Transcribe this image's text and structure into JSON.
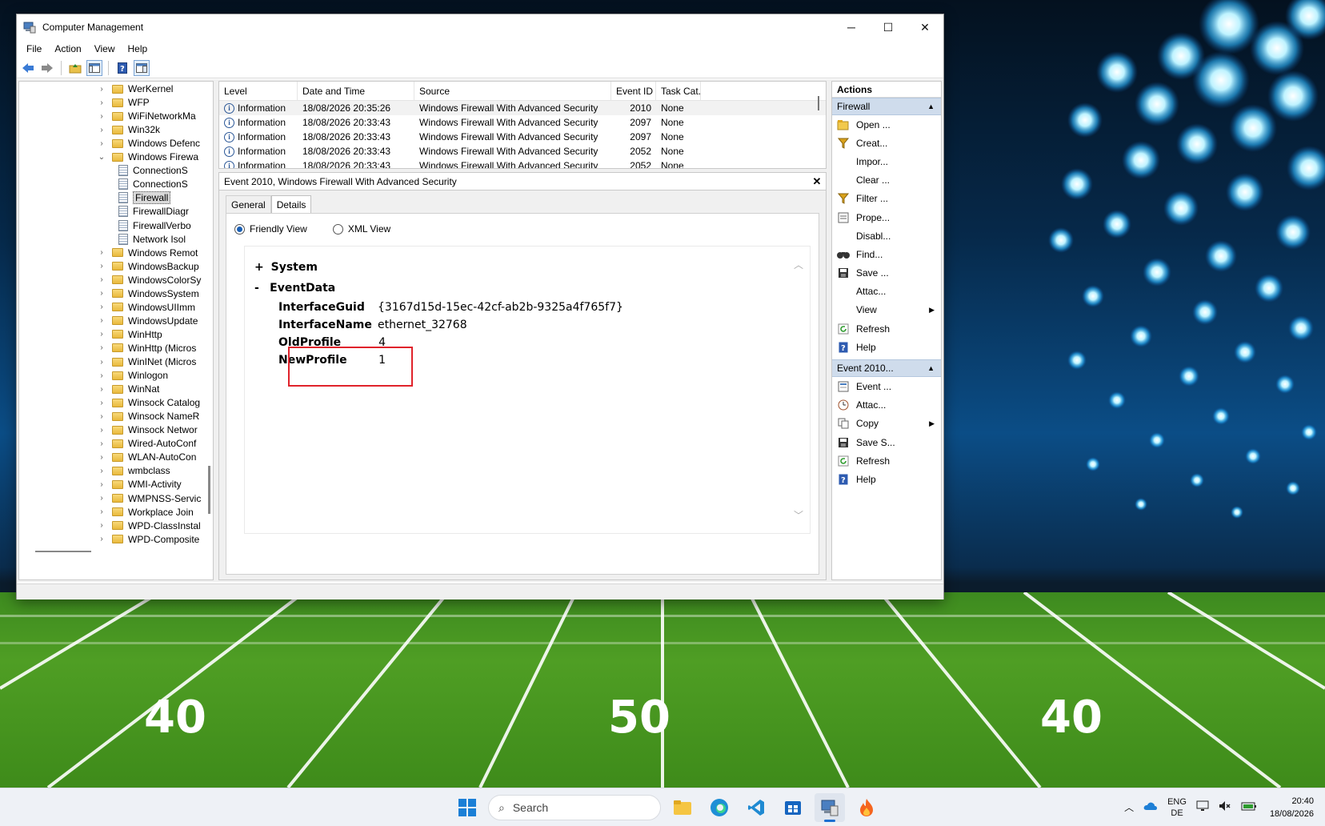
{
  "window": {
    "title": "Computer Management",
    "controls": {
      "minimize": "─",
      "maximize": "☐",
      "close": "✕"
    }
  },
  "menu": [
    "File",
    "Action",
    "View",
    "Help"
  ],
  "tree": {
    "items": [
      {
        "label": "WerKernel",
        "type": "folder",
        "expander": "›"
      },
      {
        "label": "WFP",
        "type": "folder",
        "expander": "›"
      },
      {
        "label": "WiFiNetworkMa",
        "type": "folder",
        "expander": "›"
      },
      {
        "label": "Win32k",
        "type": "folder",
        "expander": "›"
      },
      {
        "label": "Windows Defenc",
        "type": "folder",
        "expander": "›"
      },
      {
        "label": "Windows Firewa",
        "type": "folder",
        "expander": "⌄"
      },
      {
        "label": "ConnectionS",
        "type": "log",
        "expander": ""
      },
      {
        "label": "ConnectionS",
        "type": "log",
        "expander": ""
      },
      {
        "label": "Firewall",
        "type": "log",
        "expander": "",
        "selected": true
      },
      {
        "label": "FirewallDiagr",
        "type": "log",
        "expander": ""
      },
      {
        "label": "FirewallVerbo",
        "type": "log",
        "expander": ""
      },
      {
        "label": "Network Isol",
        "type": "log",
        "expander": ""
      },
      {
        "label": "Windows Remot",
        "type": "folder",
        "expander": "›"
      },
      {
        "label": "WindowsBackup",
        "type": "folder",
        "expander": "›"
      },
      {
        "label": "WindowsColorSy",
        "type": "folder",
        "expander": "›"
      },
      {
        "label": "WindowsSystem",
        "type": "folder",
        "expander": "›"
      },
      {
        "label": "WindowsUIImm",
        "type": "folder",
        "expander": "›"
      },
      {
        "label": "WindowsUpdate",
        "type": "folder",
        "expander": "›"
      },
      {
        "label": "WinHttp",
        "type": "folder",
        "expander": "›"
      },
      {
        "label": "WinHttp (Micros",
        "type": "folder",
        "expander": "›"
      },
      {
        "label": "WinINet (Micros",
        "type": "folder",
        "expander": "›"
      },
      {
        "label": "Winlogon",
        "type": "folder",
        "expander": "›"
      },
      {
        "label": "WinNat",
        "type": "folder",
        "expander": "›"
      },
      {
        "label": "Winsock Catalog",
        "type": "folder",
        "expander": "›"
      },
      {
        "label": "Winsock NameR",
        "type": "folder",
        "expander": "›"
      },
      {
        "label": "Winsock Networ",
        "type": "folder",
        "expander": "›"
      },
      {
        "label": "Wired-AutoConf",
        "type": "folder",
        "expander": "›"
      },
      {
        "label": "WLAN-AutoCon",
        "type": "folder",
        "expander": "›"
      },
      {
        "label": "wmbclass",
        "type": "folder",
        "expander": "›"
      },
      {
        "label": "WMI-Activity",
        "type": "folder",
        "expander": "›"
      },
      {
        "label": "WMPNSS-Servic",
        "type": "folder",
        "expander": "›"
      },
      {
        "label": "Workplace Join",
        "type": "folder",
        "expander": "›"
      },
      {
        "label": "WPD-ClassInstal",
        "type": "folder",
        "expander": "›"
      },
      {
        "label": "WPD-Composite",
        "type": "folder",
        "expander": "›"
      }
    ]
  },
  "events": {
    "columns": [
      "Level",
      "Date and Time",
      "Source",
      "Event ID",
      "Task Cat..."
    ],
    "rows": [
      {
        "level": "Information",
        "date": "18/08/2026 20:35:26",
        "source": "Windows Firewall With Advanced Security",
        "id": "2010",
        "task": "None",
        "selected": true
      },
      {
        "level": "Information",
        "date": "18/08/2026 20:33:43",
        "source": "Windows Firewall With Advanced Security",
        "id": "2097",
        "task": "None"
      },
      {
        "level": "Information",
        "date": "18/08/2026 20:33:43",
        "source": "Windows Firewall With Advanced Security",
        "id": "2097",
        "task": "None"
      },
      {
        "level": "Information",
        "date": "18/08/2026 20:33:43",
        "source": "Windows Firewall With Advanced Security",
        "id": "2052",
        "task": "None"
      },
      {
        "level": "Information",
        "date": "18/08/2026 20:33:43",
        "source": "Windows Firewall With Advanced Security",
        "id": "2052",
        "task": "None"
      }
    ]
  },
  "detail": {
    "title": "Event 2010, Windows Firewall With Advanced Security",
    "close": "✕",
    "tabs": [
      "General",
      "Details"
    ],
    "view_friendly": "Friendly View",
    "view_xml": "XML View",
    "system_toggle": "+",
    "system_label": "System",
    "eventdata_toggle": "-",
    "eventdata_label": "EventData",
    "fields": [
      {
        "name": "InterfaceGuid",
        "value": "{3167d15d-15ec-42cf-ab2b-9325a4f765f7}"
      },
      {
        "name": "InterfaceName",
        "value": "ethernet_32768"
      },
      {
        "name": "OldProfile",
        "value": "4"
      },
      {
        "name": "NewProfile",
        "value": "1"
      }
    ],
    "highlight_color": "#e0232b"
  },
  "actions": {
    "header": "Actions",
    "section1": {
      "title": "Firewall",
      "items": [
        {
          "label": "Open ...",
          "icon": "open-folder-icon"
        },
        {
          "label": "Creat...",
          "icon": "filter-icon"
        },
        {
          "label": "Impor...",
          "icon": ""
        },
        {
          "label": "Clear ...",
          "icon": ""
        },
        {
          "label": "Filter ...",
          "icon": "filter-icon"
        },
        {
          "label": "Prope...",
          "icon": "properties-icon"
        },
        {
          "label": "Disabl...",
          "icon": ""
        },
        {
          "label": "Find...",
          "icon": "binoculars-icon"
        },
        {
          "label": "Save ...",
          "icon": "save-icon"
        },
        {
          "label": "Attac...",
          "icon": ""
        },
        {
          "label": "View",
          "icon": "",
          "submenu": true
        },
        {
          "label": "Refresh",
          "icon": "refresh-icon"
        },
        {
          "label": "Help",
          "icon": "help-icon"
        }
      ]
    },
    "section2": {
      "title": "Event 2010...",
      "items": [
        {
          "label": "Event ...",
          "icon": "event-properties-icon"
        },
        {
          "label": "Attac...",
          "icon": "attach-task-icon"
        },
        {
          "label": "Copy",
          "icon": "copy-icon",
          "submenu": true
        },
        {
          "label": "Save S...",
          "icon": "save-icon"
        },
        {
          "label": "Refresh",
          "icon": "refresh-icon"
        },
        {
          "label": "Help",
          "icon": "help-icon"
        }
      ]
    }
  },
  "taskbar": {
    "search_placeholder": "Search",
    "apps": [
      "file-explorer-icon",
      "edge-icon",
      "vscode-icon",
      "store-icon",
      "computer-management-icon",
      "flame-app-icon"
    ],
    "lang_top": "ENG",
    "lang_bottom": "DE",
    "time": "20:40",
    "date": "18/08/2026"
  },
  "field_numbers": [
    "40",
    "50",
    "40"
  ]
}
